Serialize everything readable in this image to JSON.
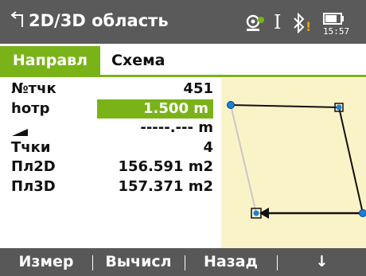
{
  "titlebar": {
    "back_icon": "back-arrow-icon",
    "title": "2D/3D область",
    "time": "15:57",
    "cursor_glyph": "I",
    "bluetooth_glyph": "✱",
    "warning_glyph": "!"
  },
  "tabs": [
    {
      "label": "Направл",
      "active": true
    },
    {
      "label": "Схема",
      "active": false
    }
  ],
  "fields": {
    "point_no": {
      "label": "№тчк",
      "value": "451"
    },
    "target_height": {
      "label": "hотр",
      "value": "1.500 m"
    },
    "height_diff": {
      "icon": "slope-icon",
      "value": "-----.--- m"
    },
    "points": {
      "label": "Тчки",
      "value": "4"
    },
    "area_2d": {
      "label": "Пл2D",
      "value": "156.591 m2"
    },
    "area_3d": {
      "label": "Пл3D",
      "value": "157.371 m2"
    }
  },
  "softkeys": [
    {
      "label": "Измер"
    },
    {
      "label": "Вычисл"
    },
    {
      "label": "Назад"
    },
    {
      "label": "↓"
    }
  ],
  "colors": {
    "accent_green": "#7ab318",
    "titlebar_bg": "#5a5a5a",
    "plot_bg": "#fbf3c8",
    "point_blue": "#1e7fd6"
  }
}
